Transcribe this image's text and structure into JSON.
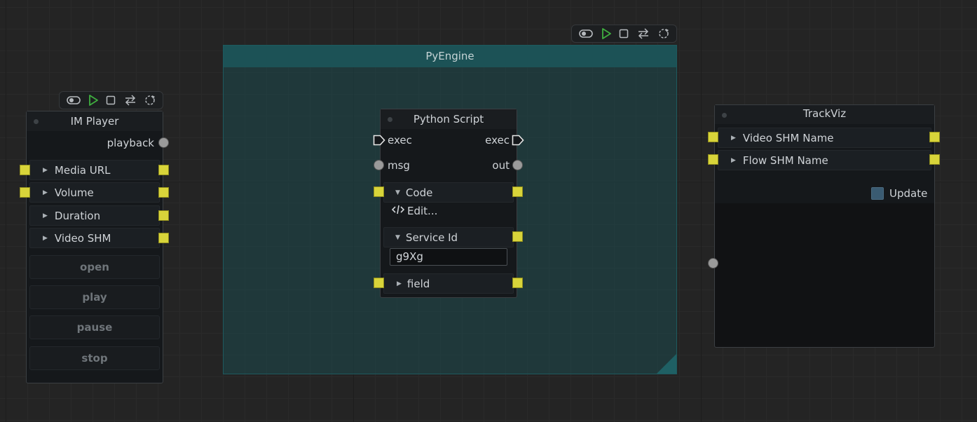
{
  "colors": {
    "pin_square": "#d8d43a",
    "pin_circle": "#9a9a9a",
    "group_fill": "#1c5256",
    "play_icon": "#3fae3f"
  },
  "toolbar_icons": [
    "toggle-icon",
    "play-icon",
    "stop-icon",
    "swap-icon",
    "reload-icon"
  ],
  "group": {
    "title": "PyEngine"
  },
  "im_player": {
    "title": "IM Player",
    "output_label": "playback",
    "fields": [
      "Media URL",
      "Volume",
      "Duration",
      "Video SHM"
    ],
    "buttons": {
      "open": "open",
      "play": "play",
      "pause": "pause",
      "stop": "stop"
    }
  },
  "python_script": {
    "title": "Python Script",
    "exec_in": "exec",
    "exec_out": "exec",
    "msg_in": "msg",
    "out_out": "out",
    "code_label": "Code",
    "edit_label": "Edit...",
    "service_id_label": "Service Id",
    "service_id_value": "g9Xg",
    "field_label": "field"
  },
  "trackviz": {
    "title": "TrackViz",
    "fields": [
      "Video SHM Name",
      "Flow SHM Name"
    ],
    "update_label": "Update"
  }
}
